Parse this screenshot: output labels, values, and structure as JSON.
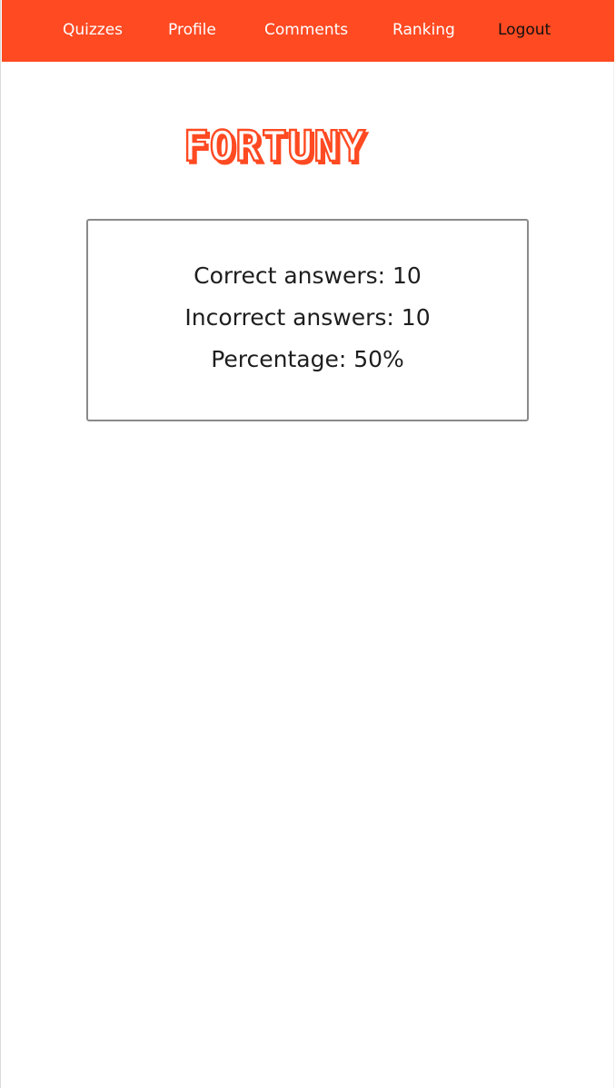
{
  "nav": {
    "items": [
      {
        "label": "Quizzes"
      },
      {
        "label": "Profile"
      },
      {
        "label": "Comments"
      },
      {
        "label": "Ranking"
      },
      {
        "label": "Logout"
      }
    ],
    "background": "#ff4a22"
  },
  "logo": {
    "text": "FORTUNY",
    "fill": "#ffffff",
    "accent": "#ff4a22"
  },
  "results": {
    "correct_line": "Correct answers: 10",
    "incorrect_line": "Incorrect answers: 10",
    "percentage_line": "Percentage: 50%"
  }
}
